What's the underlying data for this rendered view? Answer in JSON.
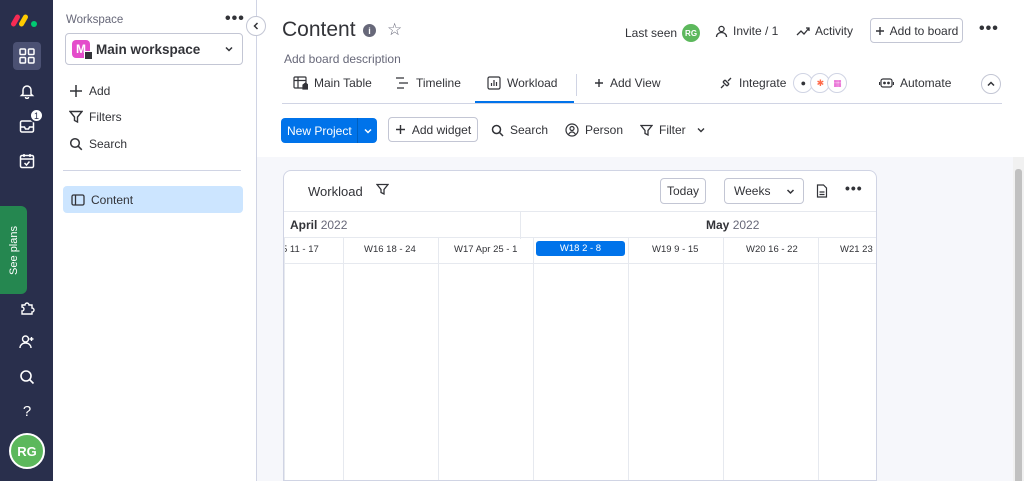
{
  "rail": {
    "badge_count": "1",
    "see_plans": "See plans",
    "avatar": "RG"
  },
  "workspace": {
    "label": "Workspace",
    "more": "•••",
    "initial": "M",
    "name": "Main workspace",
    "add": "Add",
    "filters": "Filters",
    "search": "Search",
    "board": "Content"
  },
  "header": {
    "title": "Content",
    "info": "i",
    "description": "Add board description",
    "last_seen": "Last seen",
    "last_seen_avatar": "RG",
    "invite": "Invite / 1",
    "activity": "Activity",
    "add_to_board": "Add to board",
    "more": "•••"
  },
  "tabs": {
    "main_table": "Main Table",
    "timeline": "Timeline",
    "workload": "Workload",
    "add_view": "Add View",
    "integrate": "Integrate",
    "automate": "Automate"
  },
  "toolbar": {
    "new_project": "New Project",
    "add_widget": "Add widget",
    "search": "Search",
    "person": "Person",
    "filter": "Filter"
  },
  "widget": {
    "title": "Workload",
    "today": "Today",
    "range": "Weeks",
    "more": "•••",
    "months": [
      {
        "name": "April",
        "year": "2022"
      },
      {
        "name": "May",
        "year": "2022"
      }
    ],
    "weeks": [
      {
        "label": "5   11 - 17",
        "current": false
      },
      {
        "label": "W16   18 - 24",
        "current": false
      },
      {
        "label": "W17   Apr 25 - 1",
        "current": false
      },
      {
        "label": "W18   2 - 8",
        "current": true
      },
      {
        "label": "W19   9 - 15",
        "current": false
      },
      {
        "label": "W20   16 - 22",
        "current": false
      },
      {
        "label": "W21   23",
        "current": false
      }
    ]
  },
  "colors": {
    "rail": "#292f4c",
    "primary": "#0073ea",
    "selected_board": "#cce5ff",
    "see_plans": "#258750",
    "avatar": "#5cb85c"
  }
}
